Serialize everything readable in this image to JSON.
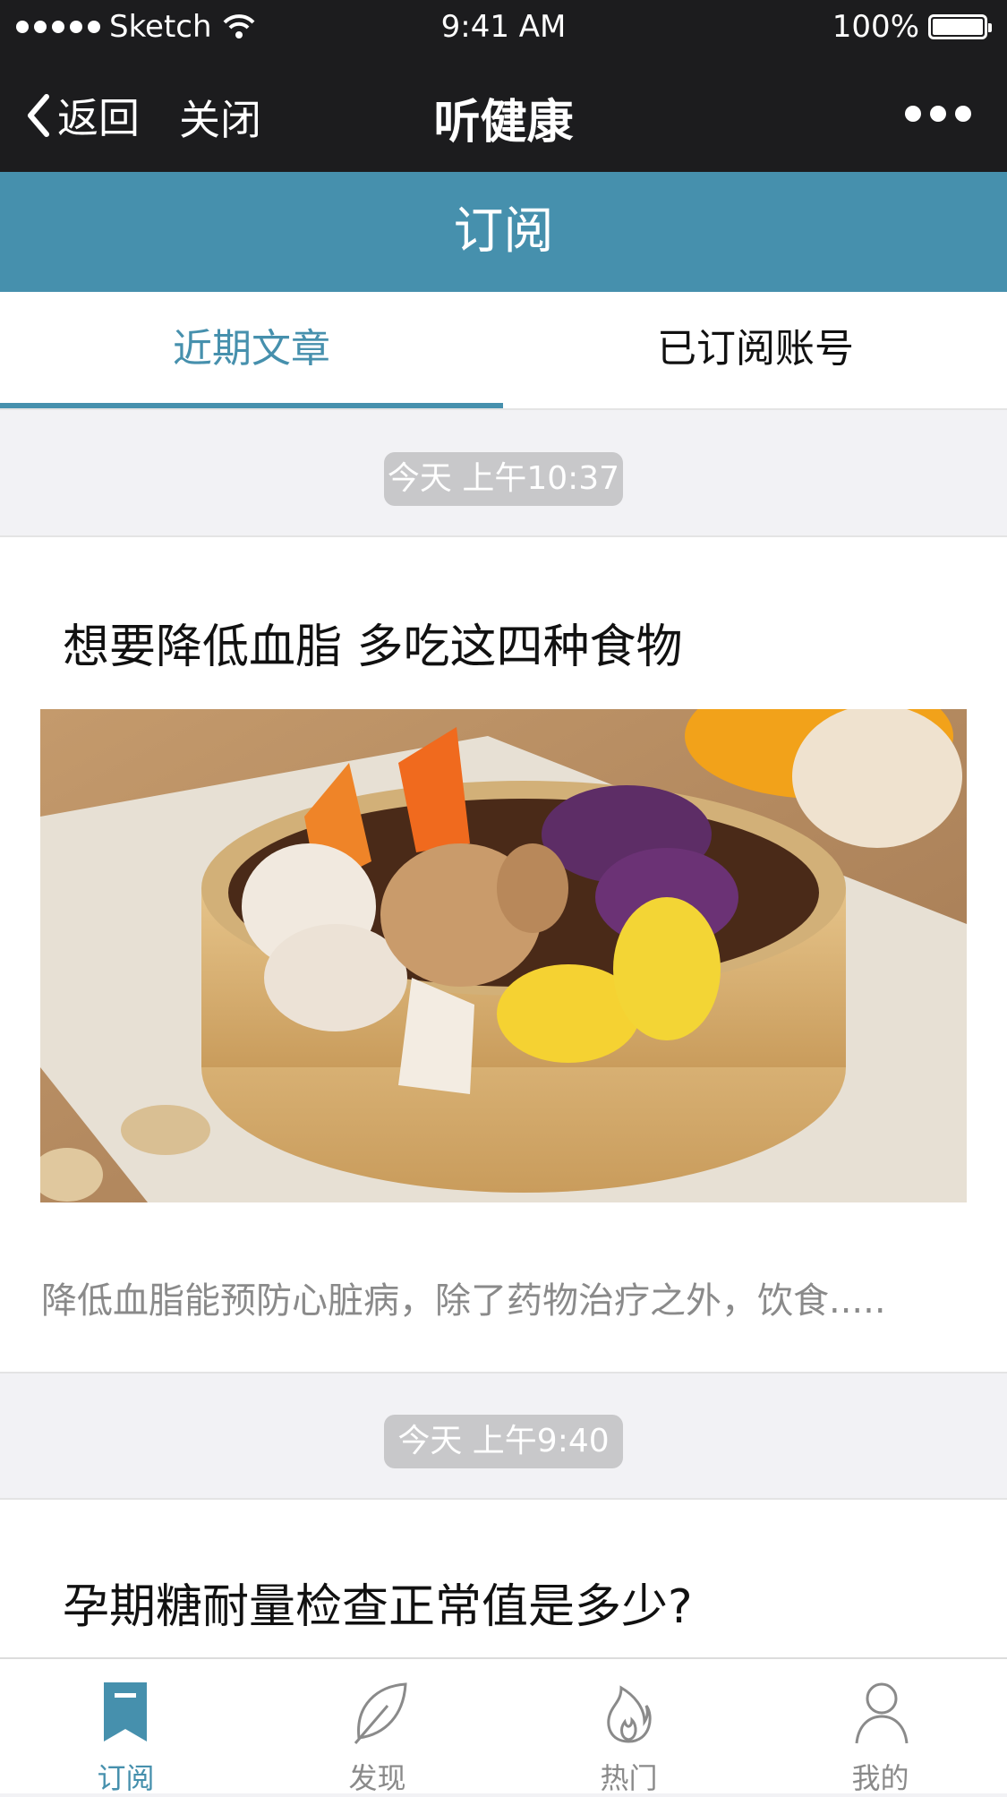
{
  "status_bar": {
    "carrier": "Sketch",
    "time": "9:41 AM",
    "battery": "100%"
  },
  "nav": {
    "back_label": "返回",
    "close_label": "关闭",
    "title": "听健康"
  },
  "section_title": "订阅",
  "tabs": [
    {
      "label": "近期文章",
      "active": true
    },
    {
      "label": "已订阅账号",
      "active": false
    }
  ],
  "articles": [
    {
      "time": "今天 上午10:37",
      "title": "想要降低血脂 多吃这四种食物",
      "summary": "降低血脂能预防心脏病，除了药物治疗之外，饮食....."
    },
    {
      "time": "今天 上午9:40",
      "title": "孕期糖耐量检查正常值是多少?"
    }
  ],
  "tab_bar": [
    {
      "label": "订阅",
      "icon": "bookmark-icon",
      "active": true
    },
    {
      "label": "发现",
      "icon": "leaf-icon",
      "active": false
    },
    {
      "label": "热门",
      "icon": "flame-icon",
      "active": false
    },
    {
      "label": "我的",
      "icon": "person-icon",
      "active": false
    }
  ],
  "colors": {
    "accent": "#4690ad",
    "bar": "#1c1c1e",
    "muted": "#8a8a8a"
  }
}
